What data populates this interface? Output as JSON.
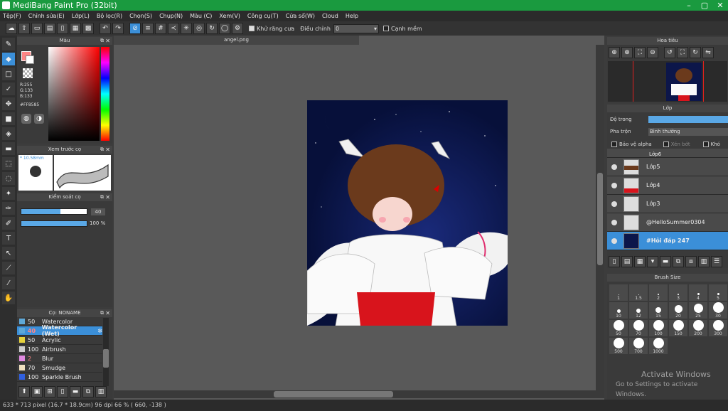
{
  "app": {
    "title": "MediBang Paint Pro (32bit)"
  },
  "menu": [
    "Tệp(F)",
    "Chỉnh sửa(E)",
    "Lớp(L)",
    "Bộ lọc(R)",
    "Chọn(S)",
    "Chụp(N)",
    "Màu (C)",
    "Xem(V)",
    "Công cụ(T)",
    "Cửa sổ(W)",
    "Cloud",
    "Help"
  ],
  "toolbar": {
    "antialias_label": "Khử răng cưa",
    "adjust_label": "Điều chỉnh",
    "adjust_value": "0",
    "soft_edge_label": "Cạnh mềm"
  },
  "color_panel": {
    "title": "Màu",
    "r": "R:255",
    "g": "G:133",
    "b": "B:133",
    "hex": "#FF8585",
    "primary": "#ff8585"
  },
  "preview_panel": {
    "title": "Xem trước cọ",
    "size": "* 10.58mm"
  },
  "brush_control": {
    "title": "Kiểm soát cọ",
    "size_value": "40",
    "opacity_value": "100 %",
    "size_fraction": 0.4,
    "opacity_fraction": 1.0
  },
  "brush_panel": {
    "title": "Cọ: NONAME",
    "items": [
      {
        "size": "50",
        "name": "Watercolor",
        "color": "#5fa8d8"
      },
      {
        "size": "40",
        "name": "Watercolor (Wet)",
        "color": "#5fa8d8"
      },
      {
        "size": "50",
        "name": "Acrylic",
        "color": "#e6d23c"
      },
      {
        "size": "100",
        "name": "Airbrush",
        "color": "#cccccc"
      },
      {
        "size": "2",
        "name": "Blur",
        "color": "#e08ae0"
      },
      {
        "size": "70",
        "name": "Smudge",
        "color": "#f0e0c0"
      },
      {
        "size": "100",
        "name": "Sparkle Brush",
        "color": "#3060e0"
      }
    ]
  },
  "document": {
    "tab": "angel.png"
  },
  "navigator": {
    "title": "Hoa tiêu"
  },
  "layers_panel": {
    "title": "Lớp",
    "opacity_label": "Độ trong",
    "blend_label": "Pha trộn",
    "blend_value": "Bình thường",
    "protect_alpha": "Bảo vệ alpha",
    "clipping": "Xén bớt",
    "lock_label": "Khó",
    "partial_top": "Lớp6",
    "items": [
      "Lớp5",
      "Lớp4",
      "Lớp3",
      "@HelloSummer0304",
      "#Hỏi đáp 247"
    ]
  },
  "brush_size": {
    "title": "Brush Size",
    "sizes": [
      "1",
      "1.5",
      "2",
      "3",
      "4",
      "5",
      "10",
      "12",
      "15",
      "20",
      "25",
      "30",
      "50",
      "70",
      "100",
      "150",
      "200",
      "300",
      "500",
      "700",
      "1000"
    ]
  },
  "status": {
    "text": "633 * 713 pixel   (16.7 * 18.9cm)   96 dpi   66 %   ( 660, -138 )"
  },
  "watermark": {
    "line1": "Activate Windows",
    "line2": "Go to Settings to activate Windows."
  }
}
